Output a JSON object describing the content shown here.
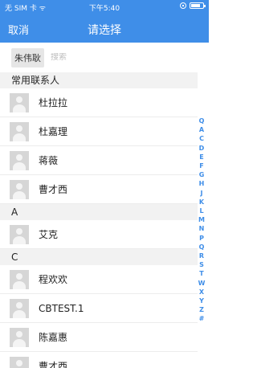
{
  "status_bar": {
    "carrier": "无 SIM 卡",
    "wifi": "ᯤ",
    "time": "下午5:40"
  },
  "nav": {
    "cancel_label": "取消",
    "title": "请选择"
  },
  "search": {
    "selected_chip": "朱伟耿",
    "placeholder": "搜索"
  },
  "sections": {
    "frequent": {
      "header": "常用联系人",
      "contacts": [
        "杜拉拉",
        "杜嘉理",
        "蒋薇",
        "曹才西"
      ]
    },
    "a": {
      "header": "A",
      "contacts": [
        "艾克"
      ]
    },
    "c": {
      "header": "C",
      "contacts": [
        "程欢欢",
        "CBTEST.1",
        "陈嘉惠",
        "曹才西"
      ]
    }
  },
  "index": [
    "Q",
    "A",
    "C",
    "D",
    "E",
    "F",
    "G",
    "H",
    "J",
    "K",
    "L",
    "M",
    "N",
    "P",
    "Q",
    "R",
    "S",
    "T",
    "W",
    "X",
    "Y",
    "Z",
    "#"
  ]
}
